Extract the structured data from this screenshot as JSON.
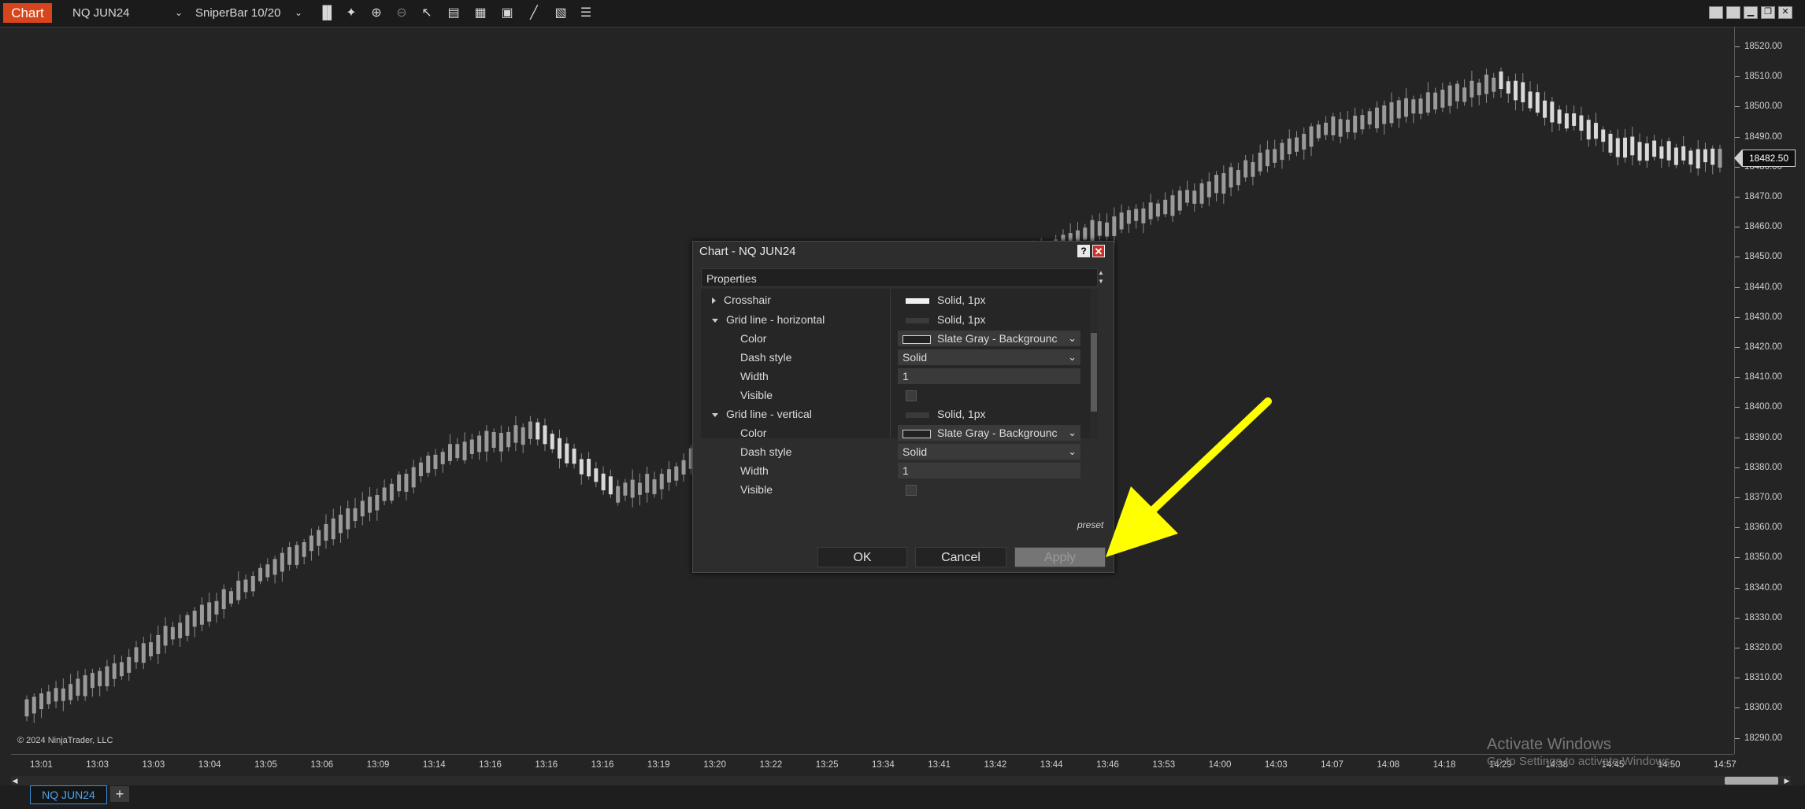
{
  "toolbar": {
    "chart_tab": "Chart",
    "instrument": "NQ JUN24",
    "bar_type": "SniperBar 10/20",
    "icons": [
      "bar-type-icon",
      "draw-tools-icon",
      "zoom-in-icon",
      "zoom-out-icon",
      "select-icon",
      "properties-icon",
      "templates-icon",
      "data-box-icon",
      "strategies-icon",
      "indicators-icon",
      "show-list-icon"
    ],
    "window_buttons": [
      "tile-icon",
      "tile-icon",
      "minimize-icon",
      "restore-icon",
      "close-icon"
    ]
  },
  "chart": {
    "current_price": "18482.50",
    "copyright": "© 2024 NinjaTrader, LLC",
    "price_labels": [
      "18520.00",
      "18510.00",
      "18500.00",
      "18490.00",
      "18480.00",
      "18470.00",
      "18460.00",
      "18450.00",
      "18440.00",
      "18430.00",
      "18420.00",
      "18410.00",
      "18400.00",
      "18390.00",
      "18380.00",
      "18370.00",
      "18360.00",
      "18350.00",
      "18340.00",
      "18330.00",
      "18320.00",
      "18310.00",
      "18300.00",
      "18290.00"
    ],
    "time_labels": [
      "13:01",
      "13:03",
      "13:03",
      "13:04",
      "13:05",
      "13:06",
      "13:09",
      "13:14",
      "13:16",
      "13:16",
      "13:16",
      "13:19",
      "13:20",
      "13:22",
      "13:25",
      "13:34",
      "13:41",
      "13:42",
      "13:44",
      "13:46",
      "13:53",
      "14:00",
      "14:03",
      "14:07",
      "14:08",
      "14:18",
      "14:29",
      "14:38",
      "14:45",
      "14:50",
      "14:57"
    ],
    "watermark_title": "Activate Windows",
    "watermark_sub": "Go to Settings to activate Windows."
  },
  "tabs": {
    "active": "NQ JUN24",
    "add": "+"
  },
  "dialog": {
    "title": "Chart - NQ JUN24",
    "help": "?",
    "close": "✕",
    "section": "Properties",
    "crosshair": {
      "label": "Crosshair",
      "value": "Solid, 1px",
      "swatch_color": "#f0f0f0"
    },
    "grid_h": {
      "label": "Grid line - horizontal",
      "value": "Solid, 1px",
      "swatch_color": "#3a3a3a",
      "color_label": "Color",
      "color_value": "Slate Gray - Backgrounc",
      "dash_label": "Dash style",
      "dash_value": "Solid",
      "width_label": "Width",
      "width_value": "1",
      "visible_label": "Visible"
    },
    "grid_v": {
      "label": "Grid line - vertical",
      "value": "Solid, 1px",
      "swatch_color": "#3a3a3a",
      "color_label": "Color",
      "color_value": "Slate Gray - Backgrounc",
      "dash_label": "Dash style",
      "dash_value": "Solid",
      "width_label": "Width",
      "width_value": "1",
      "visible_label": "Visible"
    },
    "preset": "preset",
    "ok": "OK",
    "cancel": "Cancel",
    "apply": "Apply"
  },
  "annotation": {
    "arrow_color": "#ffff00",
    "points_to": "apply-button"
  },
  "colors": {
    "chart_bg": "#242424",
    "candle_up": "#9a9a9a",
    "candle_down": "#d9d9d9",
    "brand": "#d6451b",
    "tab_accent": "#3b8dd6"
  }
}
